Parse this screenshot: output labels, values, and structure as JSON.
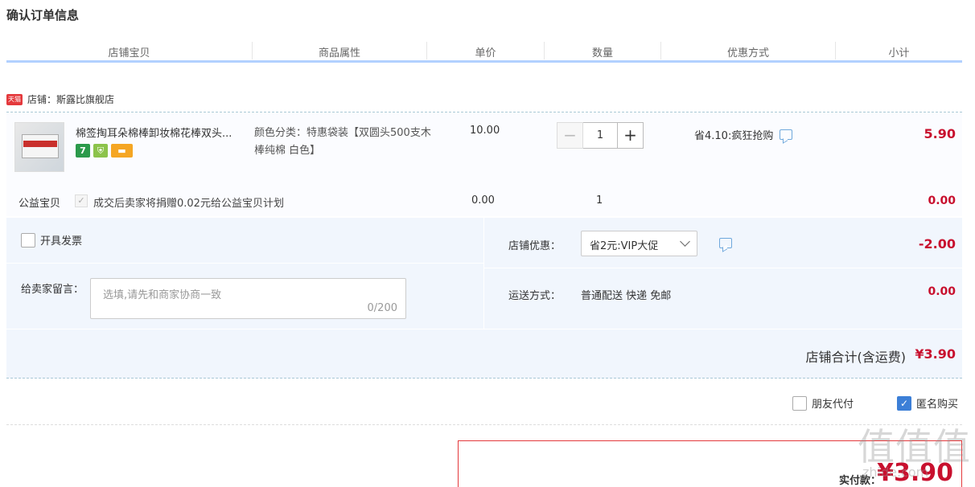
{
  "page": {
    "title": "确认订单信息"
  },
  "columns": [
    "店铺宝贝",
    "商品属性",
    "单价",
    "数量",
    "优惠方式",
    "小计"
  ],
  "shop": {
    "badge": "天猫",
    "label": "店铺：斯露比旗舰店"
  },
  "item": {
    "title": "棉签掏耳朵棉棒卸妆棉花棒双头...",
    "badges": {
      "seven": "7",
      "shield": "⛨",
      "card": "▬"
    },
    "attribute": "颜色分类：特惠袋装【双圆头500支木棒纯棉 白色】",
    "price": "10.00",
    "quantity": "1",
    "promotion": "省4.10:疯狂抢购",
    "subtotal": "5.90"
  },
  "charity": {
    "label": "公益宝贝",
    "text": "成交后卖家将捐赠0.02元给公益宝贝计划",
    "price": "0.00",
    "quantity": "1",
    "subtotal": "0.00"
  },
  "invoice": {
    "label": "开具发票"
  },
  "memo": {
    "label": "给卖家留言：",
    "placeholder": "选填,请先和商家协商一致",
    "count": "0/200"
  },
  "discount": {
    "label": "店铺优惠：",
    "selected": "省2元:VIP大促",
    "amount": "-2.00"
  },
  "shipping": {
    "label": "运送方式：",
    "value": "普通配送 快递 免邮",
    "amount": "0.00"
  },
  "total": {
    "label": "店铺合计(含运费)",
    "value": "¥3.90"
  },
  "options": {
    "friend_pay": "朋友代付",
    "anonymous": "匿名购买"
  },
  "payment": {
    "label": "实付款：",
    "amount": "¥3.90"
  },
  "watermark": {
    "main": "值值值",
    "sub": "zhide.com"
  },
  "colors": {
    "accent": "#c8102e",
    "border_blue": "#b2d1ff",
    "panel": "#f1f6fd"
  }
}
